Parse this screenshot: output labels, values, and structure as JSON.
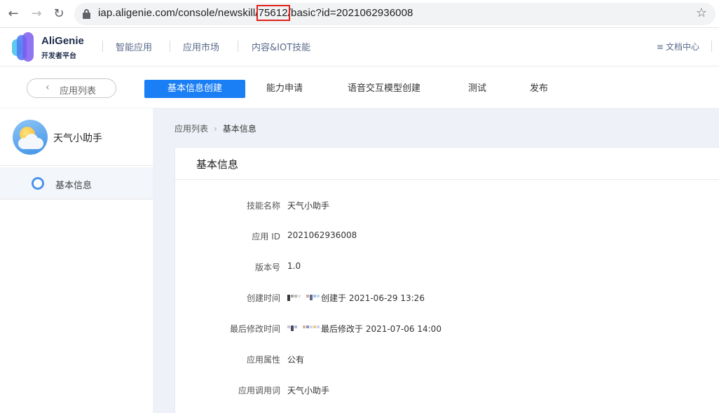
{
  "browser": {
    "url_prefix": "iap.aligenie.com/console/newskill/",
    "url_highlight": "75612",
    "url_suffix": "/basic?id=2021062936008"
  },
  "header": {
    "logo_name": "AliGenie",
    "logo_sub": "开发者平台",
    "nav": [
      "智能应用",
      "应用市场",
      "内容&IOT技能"
    ],
    "doc_link": "文档中心"
  },
  "steps": {
    "back_label": "应用列表",
    "items": [
      "基本信息创建",
      "能力申请",
      "语音交互模型创建",
      "测试",
      "发布"
    ],
    "active_index": 0
  },
  "sidebar": {
    "app_name": "天气小助手",
    "items": [
      {
        "label": "基本信息",
        "icon": "ring-icon"
      }
    ]
  },
  "breadcrumb": {
    "parent": "应用列表",
    "current": "基本信息"
  },
  "panel": {
    "title": "基本信息",
    "fields": [
      {
        "label": "技能名称",
        "value": "天气小助手"
      },
      {
        "label": "应用 ID",
        "value": "2021062936008"
      },
      {
        "label": "版本号",
        "value": "1.0"
      },
      {
        "label": "创建时间",
        "value": "创建于 2021-06-29 13:26",
        "blurred_prefix": true
      },
      {
        "label": "最后修改时间",
        "value": "最后修改于 2021-07-06 14:00",
        "blurred_prefix": true
      },
      {
        "label": "应用属性",
        "value": "公有"
      },
      {
        "label": "应用调用词",
        "value": "天气小助手"
      }
    ]
  },
  "colors": {
    "accent": "#1a7ef4",
    "url_highlight_border": "#e0201a",
    "content_bg": "#eef2f8"
  }
}
